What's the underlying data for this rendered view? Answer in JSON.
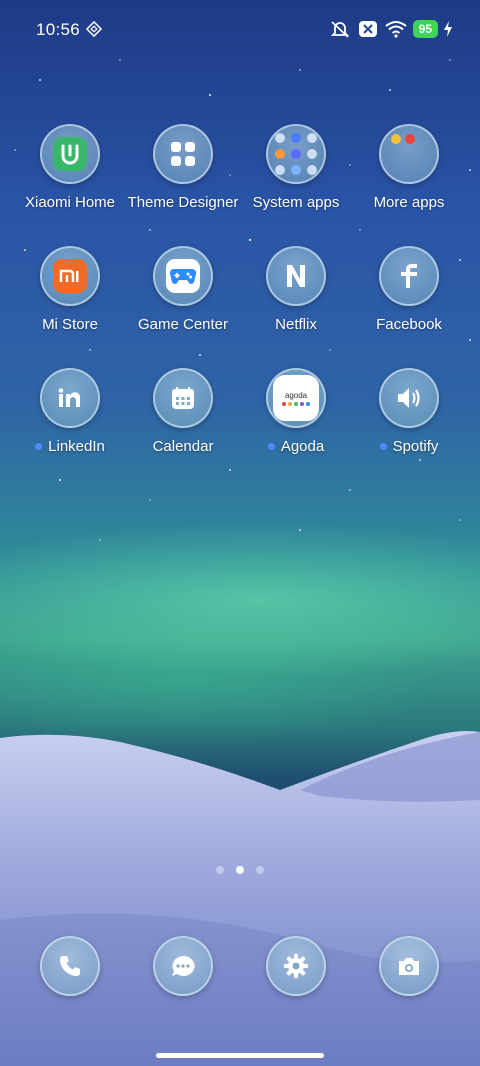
{
  "status_bar": {
    "time": "10:56",
    "battery": "95",
    "icons": [
      "nfc-icon",
      "mute-icon",
      "close-notification-icon",
      "wifi-icon",
      "charging-icon"
    ]
  },
  "apps": [
    {
      "label": "Xiaomi Home",
      "icon": "xiaomi-home-icon",
      "new": false
    },
    {
      "label": "Theme Designer",
      "icon": "theme-designer-icon",
      "new": false
    },
    {
      "label": "System apps",
      "icon": "folder-icon",
      "new": false
    },
    {
      "label": "More apps",
      "icon": "folder-icon",
      "new": false
    },
    {
      "label": "Mi Store",
      "icon": "mi-store-icon",
      "new": false
    },
    {
      "label": "Game Center",
      "icon": "game-controller-icon",
      "new": false
    },
    {
      "label": "Netflix",
      "icon": "netflix-icon",
      "new": false
    },
    {
      "label": "Facebook",
      "icon": "facebook-icon",
      "new": false
    },
    {
      "label": "LinkedIn",
      "icon": "linkedin-icon",
      "new": true
    },
    {
      "label": "Calendar",
      "icon": "calendar-icon",
      "new": false
    },
    {
      "label": "Agoda",
      "icon": "agoda-icon",
      "new": true,
      "logo_text": "agoda"
    },
    {
      "label": "Spotify",
      "icon": "spotify-icon",
      "new": true
    }
  ],
  "page_indicator": {
    "count": 3,
    "active": 2
  },
  "dock": [
    "phone-icon",
    "messages-icon",
    "settings-icon",
    "camera-icon"
  ],
  "colors": {
    "new_dot": "#4e8bff",
    "mi_orange": "#f06a28",
    "battery_green": "#3fd35a"
  }
}
